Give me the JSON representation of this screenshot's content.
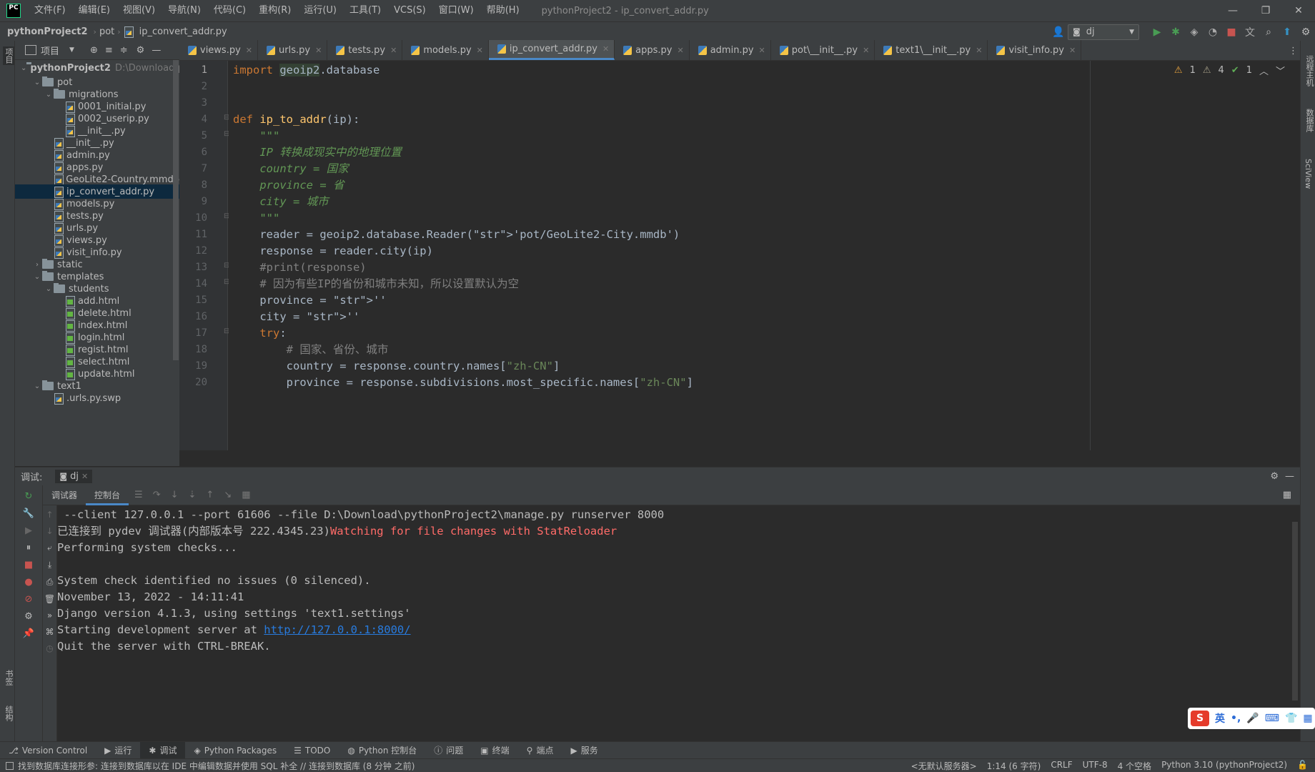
{
  "app": {
    "logo": "PC",
    "window_title": "pythonProject2 - ip_convert_addr.py",
    "menu": [
      "文件(F)",
      "编辑(E)",
      "视图(V)",
      "导航(N)",
      "代码(C)",
      "重构(R)",
      "运行(U)",
      "工具(T)",
      "VCS(S)",
      "窗口(W)",
      "帮助(H)"
    ]
  },
  "navbar": {
    "crumbs": [
      "pythonProject2",
      "pot",
      "ip_convert_addr.py"
    ],
    "run_config": "dj"
  },
  "project": {
    "header": "项目",
    "root_name": "pythonProject2",
    "root_path": "D:\\Download\\p",
    "tree": [
      {
        "label": "pot",
        "type": "folder",
        "depth": 1,
        "open": true
      },
      {
        "label": "migrations",
        "type": "folder",
        "depth": 2,
        "open": true
      },
      {
        "label": "0001_initial.py",
        "type": "py",
        "depth": 3
      },
      {
        "label": "0002_userip.py",
        "type": "py",
        "depth": 3
      },
      {
        "label": "__init__.py",
        "type": "py",
        "depth": 3
      },
      {
        "label": "__init__.py",
        "type": "py",
        "depth": 2
      },
      {
        "label": "admin.py",
        "type": "py",
        "depth": 2
      },
      {
        "label": "apps.py",
        "type": "py",
        "depth": 2
      },
      {
        "label": "GeoLite2-Country.mmdb",
        "type": "py",
        "depth": 2
      },
      {
        "label": "ip_convert_addr.py",
        "type": "py",
        "depth": 2,
        "selected": true
      },
      {
        "label": "models.py",
        "type": "py",
        "depth": 2
      },
      {
        "label": "tests.py",
        "type": "py",
        "depth": 2
      },
      {
        "label": "urls.py",
        "type": "py",
        "depth": 2
      },
      {
        "label": "views.py",
        "type": "py",
        "depth": 2
      },
      {
        "label": "visit_info.py",
        "type": "py",
        "depth": 2
      },
      {
        "label": "static",
        "type": "folder",
        "depth": 1,
        "open": false
      },
      {
        "label": "templates",
        "type": "folder",
        "depth": 1,
        "open": true
      },
      {
        "label": "students",
        "type": "folder",
        "depth": 2,
        "open": true
      },
      {
        "label": "add.html",
        "type": "html",
        "depth": 3
      },
      {
        "label": "delete.html",
        "type": "html",
        "depth": 3
      },
      {
        "label": "index.html",
        "type": "html",
        "depth": 3
      },
      {
        "label": "login.html",
        "type": "html",
        "depth": 3
      },
      {
        "label": "regist.html",
        "type": "html",
        "depth": 3
      },
      {
        "label": "select.html",
        "type": "html",
        "depth": 3
      },
      {
        "label": "update.html",
        "type": "html",
        "depth": 3
      },
      {
        "label": "text1",
        "type": "folder",
        "depth": 1,
        "open": true
      },
      {
        "label": ".urls.py.swp",
        "type": "py",
        "depth": 2
      }
    ]
  },
  "tabs": [
    "views.py",
    "urls.py",
    "tests.py",
    "models.py",
    "ip_convert_addr.py",
    "apps.py",
    "admin.py",
    "pot\\__init__.py",
    "text1\\__init__.py",
    "visit_info.py"
  ],
  "active_tab": "ip_convert_addr.py",
  "inspections": {
    "warnings": "1",
    "weak": "4",
    "ok": "1"
  },
  "code": [
    {
      "n": "1",
      "t": "import geoip2.database"
    },
    {
      "n": "2",
      "t": ""
    },
    {
      "n": "3",
      "t": ""
    },
    {
      "n": "4",
      "t": "def ip_to_addr(ip):"
    },
    {
      "n": "5",
      "t": "    \"\"\""
    },
    {
      "n": "6",
      "t": "    IP 转换成现实中的地理位置"
    },
    {
      "n": "7",
      "t": "    country = 国家"
    },
    {
      "n": "8",
      "t": "    province = 省"
    },
    {
      "n": "9",
      "t": "    city = 城市"
    },
    {
      "n": "10",
      "t": "    \"\"\""
    },
    {
      "n": "11",
      "t": "    reader = geoip2.database.Reader('pot/GeoLite2-City.mmdb')"
    },
    {
      "n": "12",
      "t": "    response = reader.city(ip)"
    },
    {
      "n": "13",
      "t": "    #print(response)"
    },
    {
      "n": "14",
      "t": "    # 因为有些IP的省份和城市未知，所以设置默认为空"
    },
    {
      "n": "15",
      "t": "    province = ''"
    },
    {
      "n": "16",
      "t": "    city = ''"
    },
    {
      "n": "17",
      "t": "    try:"
    },
    {
      "n": "18",
      "t": "        # 国家、省份、城市"
    },
    {
      "n": "19",
      "t": "        country = response.country.names[\"zh-CN\"]"
    },
    {
      "n": "20",
      "t": "        province = response.subdivisions.most_specific.names[\"zh-CN\"]"
    }
  ],
  "debug": {
    "label": "调试:",
    "session": "dj",
    "tabs": [
      "调试器",
      "控制台"
    ],
    "console": [
      {
        "text": " --client 127.0.0.1 --port 61606 --file D:\\Download\\pythonProject2\\manage.py runserver 8000"
      },
      {
        "text": "已连接到 pydev 调试器(内部版本号 222.4345.23)",
        "red": "Watching for file changes with StatReloader"
      },
      {
        "text": "Performing system checks..."
      },
      {
        "text": ""
      },
      {
        "text": "System check identified no issues (0 silenced)."
      },
      {
        "text": "November 13, 2022 - 14:11:41"
      },
      {
        "text": "Django version 4.1.3, using settings 'text1.settings'"
      },
      {
        "text": "Starting development server at ",
        "link": "http://127.0.0.1:8000/"
      },
      {
        "text": "Quit the server with CTRL-BREAK."
      }
    ]
  },
  "toolwindows": [
    "Version Control",
    "运行",
    "调试",
    "Python Packages",
    "TODO",
    "Python 控制台",
    "问题",
    "终端",
    "端点",
    "服务"
  ],
  "active_toolwindow": "调试",
  "status": {
    "message": "找到数据库连接形参: 连接到数据库以在 IDE 中编辑数据并使用 SQL 补全 // 连接到数据库 (8 分钟 之前)",
    "server": "<无默认服务器>",
    "position": "1:14 (6 字符)",
    "line_sep": "CRLF",
    "encoding": "UTF-8",
    "indent": "4 个空格",
    "interpreter": "Python 3.10 (pythonProject2)"
  },
  "left_strip": [
    "项目",
    "书签",
    "结构"
  ],
  "right_strip": [
    "远程主机",
    "数据库",
    "SciView"
  ],
  "ime": {
    "lang": "英"
  }
}
